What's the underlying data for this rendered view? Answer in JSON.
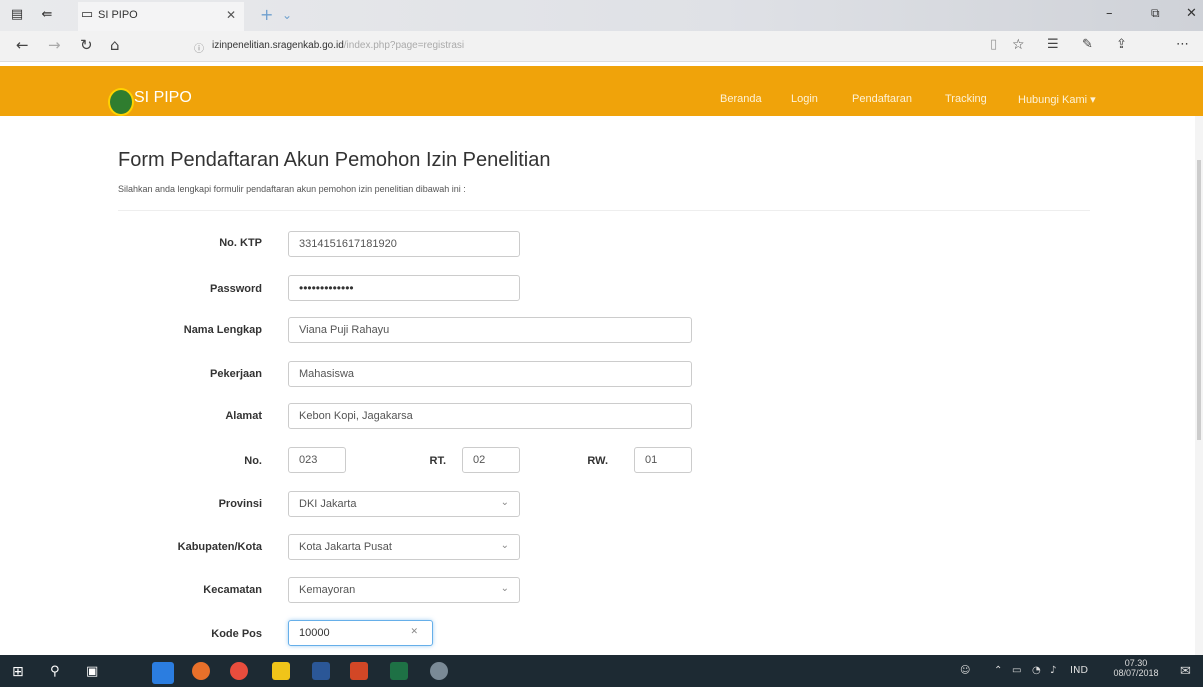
{
  "browser": {
    "tab_title": "SI PIPO",
    "url_host": "izinpenelitian.sragenkab.go.id",
    "url_path": "/index.php?page=registrasi"
  },
  "site": {
    "brand": "SI PIPO",
    "nav": [
      "Beranda",
      "Login",
      "Pendaftaran",
      "Tracking",
      "Hubungi Kami ▾"
    ]
  },
  "form": {
    "title": "Form Pendaftaran Akun Pemohon Izin Penelitian",
    "subtitle": "Silahkan anda lengkapi formulir pendaftaran akun pemohon izin penelitian dibawah ini :",
    "fields": {
      "ktp": {
        "label": "No. KTP",
        "value": "3314151617181920"
      },
      "password": {
        "label": "Password",
        "value": "•••••••••••••"
      },
      "nama": {
        "label": "Nama Lengkap",
        "value": "Viana Puji Rahayu"
      },
      "pekerjaan": {
        "label": "Pekerjaan",
        "value": "Mahasiswa"
      },
      "alamat": {
        "label": "Alamat",
        "value": "Kebon Kopi, Jagakarsa"
      },
      "no": {
        "label": "No.",
        "value": "023"
      },
      "rt": {
        "label": "RT.",
        "value": "02"
      },
      "rw": {
        "label": "RW.",
        "value": "01"
      },
      "provinsi": {
        "label": "Provinsi",
        "value": "DKI Jakarta"
      },
      "kabupaten": {
        "label": "Kabupaten/Kota",
        "value": "Kota Jakarta Pusat"
      },
      "kecamatan": {
        "label": "Kecamatan",
        "value": "Kemayoran"
      },
      "kodepos": {
        "label": "Kode Pos",
        "value": "10000"
      }
    }
  },
  "taskbar": {
    "lang": "IND",
    "time": "07.30",
    "date": "08/07/2018"
  }
}
